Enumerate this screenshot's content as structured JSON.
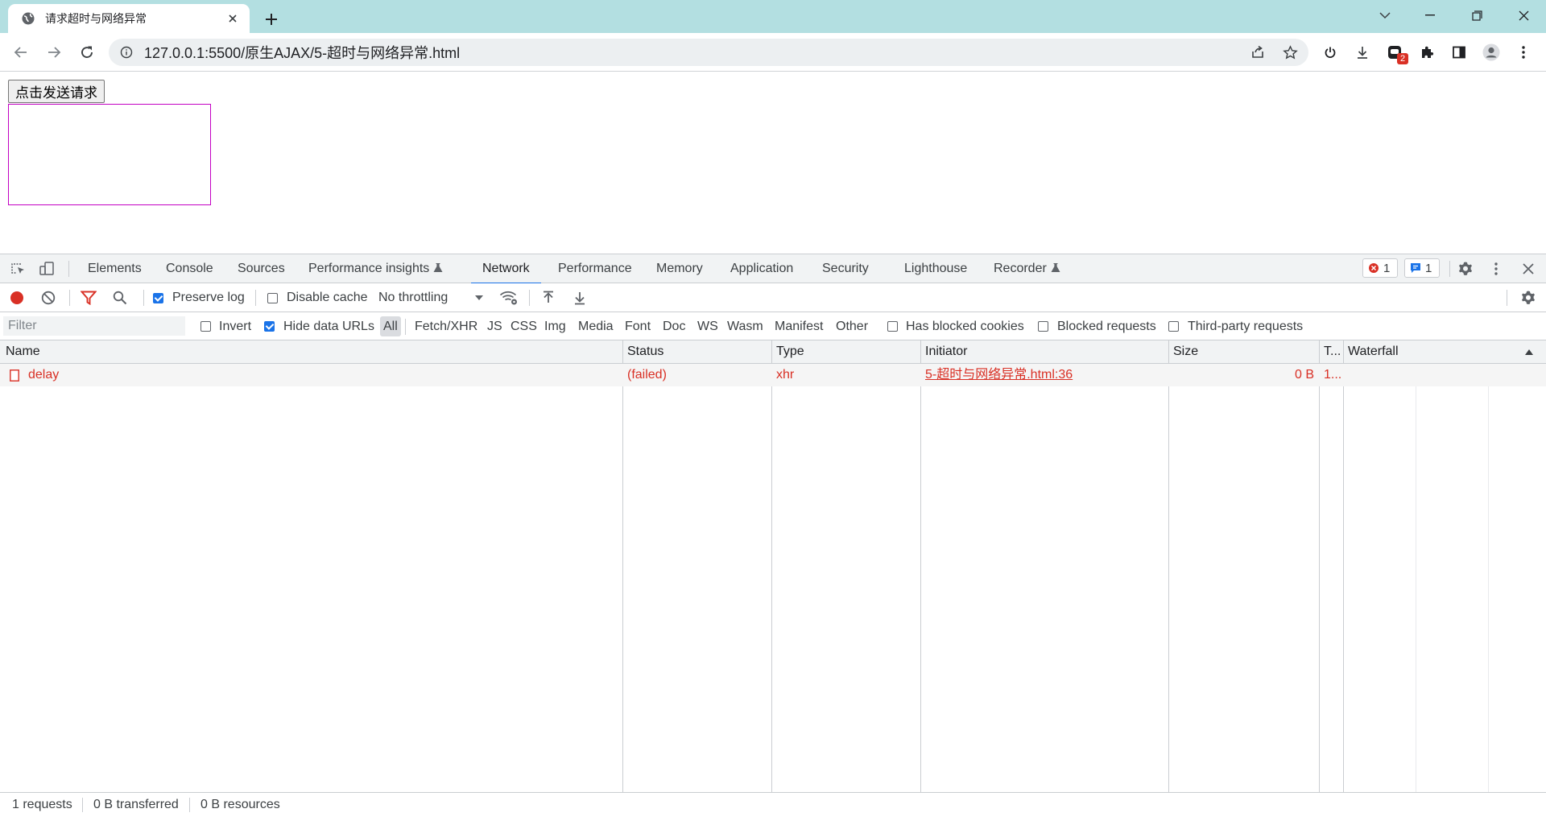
{
  "browser": {
    "tab_title": "请求超时与网络异常",
    "url": "127.0.0.1:5500/原生AJAX/5-超时与网络异常.html",
    "extension_badge": "2"
  },
  "page": {
    "button_label": "点击发送请求"
  },
  "devtools": {
    "tabs": [
      {
        "label": "Elements"
      },
      {
        "label": "Console"
      },
      {
        "label": "Sources"
      },
      {
        "label": "Performance insights"
      },
      {
        "label": "Network",
        "active": true
      },
      {
        "label": "Performance"
      },
      {
        "label": "Memory"
      },
      {
        "label": "Application"
      },
      {
        "label": "Security"
      },
      {
        "label": "Lighthouse"
      },
      {
        "label": "Recorder"
      }
    ],
    "errors_count": "1",
    "messages_count": "1",
    "toolbar": {
      "preserve_log": "Preserve log",
      "preserve_log_checked": true,
      "disable_cache": "Disable cache",
      "disable_cache_checked": false,
      "throttling": "No throttling"
    },
    "filter": {
      "placeholder": "Filter",
      "invert": "Invert",
      "hide_data_urls": "Hide data URLs",
      "types": [
        "All",
        "Fetch/XHR",
        "JS",
        "CSS",
        "Img",
        "Media",
        "Font",
        "Doc",
        "WS",
        "Wasm",
        "Manifest",
        "Other"
      ],
      "selected_type": "All",
      "has_blocked_cookies": "Has blocked cookies",
      "blocked_requests": "Blocked requests",
      "third_party_requests": "Third-party requests"
    },
    "columns": [
      "Name",
      "Status",
      "Type",
      "Initiator",
      "Size",
      "T...",
      "Waterfall"
    ],
    "requests": [
      {
        "name": "delay",
        "status": "(failed)",
        "type": "xhr",
        "initiator": "5-超时与网络异常.html:36",
        "size": "0 B",
        "time": "1..."
      }
    ],
    "status": {
      "requests": "1 requests",
      "transferred": "0 B transferred",
      "resources": "0 B resources"
    },
    "colors": {
      "error": "#d93025",
      "accent": "#1a73e8",
      "record": "#d93025"
    }
  }
}
